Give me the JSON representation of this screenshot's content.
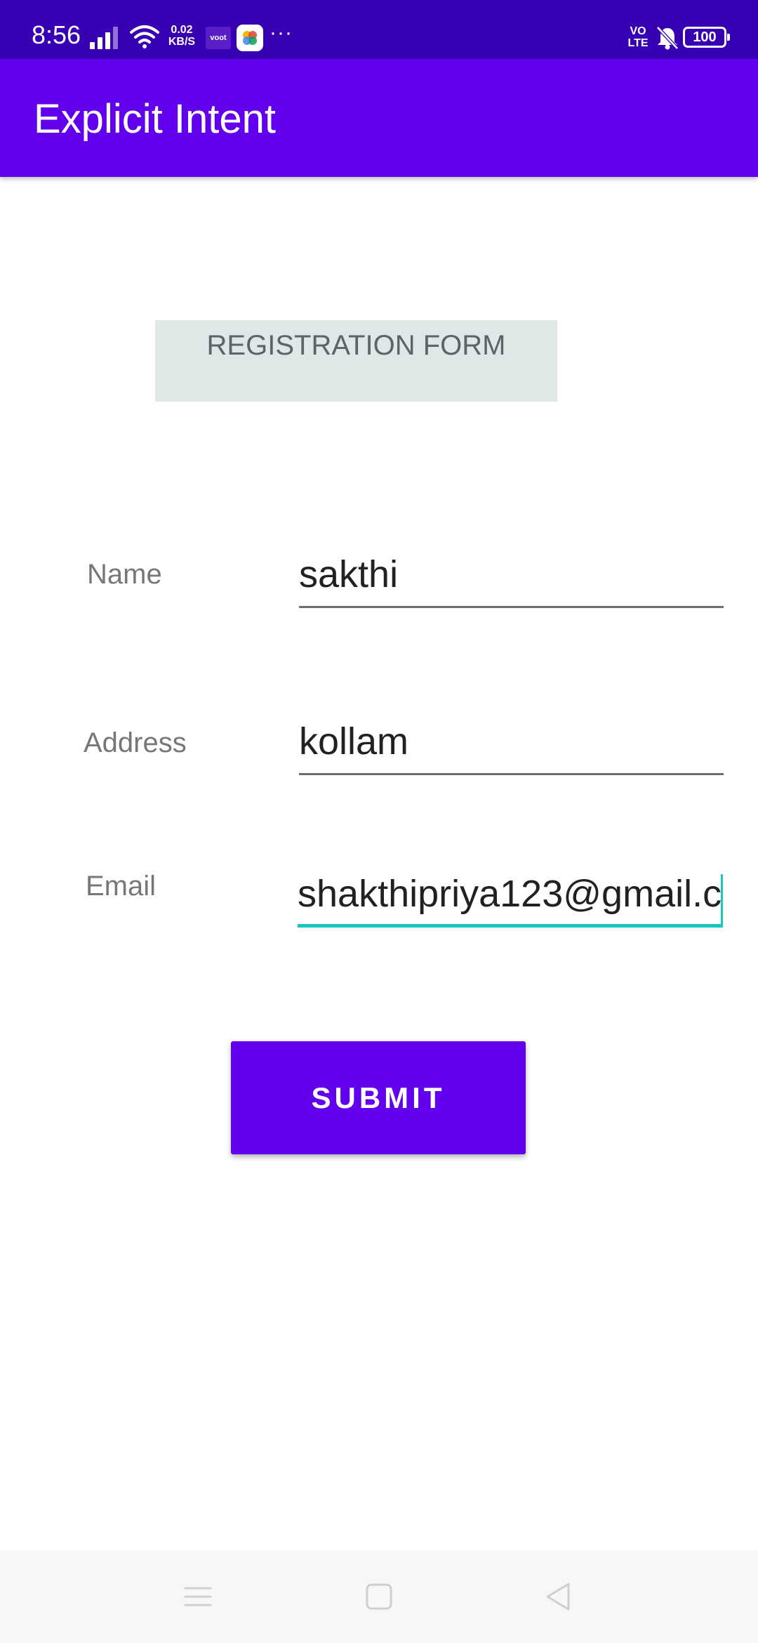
{
  "status_bar": {
    "time": "8:56",
    "net_speed_value": "0.02",
    "net_speed_unit": "KB/S",
    "voot_label": "voot",
    "more_label": "···",
    "volte_top": "VO",
    "volte_bottom": "LTE",
    "battery": "100",
    "colors": {
      "background": "#3700b3"
    }
  },
  "app_bar": {
    "title": "Explicit Intent",
    "background": "#6200ee"
  },
  "form": {
    "header": "REGISTRATION FORM",
    "fields": [
      {
        "label": "Name",
        "value": "sakthi"
      },
      {
        "label": "Address",
        "value": "kollam"
      },
      {
        "label": "Email",
        "value": "shakthipriya123@gmail.c"
      }
    ],
    "focused_field": "Email",
    "accent_color": "#18c8c0",
    "submit_label": "SUBMIT"
  },
  "nav_bar": {
    "icons": [
      "menu-icon",
      "home-icon",
      "back-icon"
    ]
  }
}
